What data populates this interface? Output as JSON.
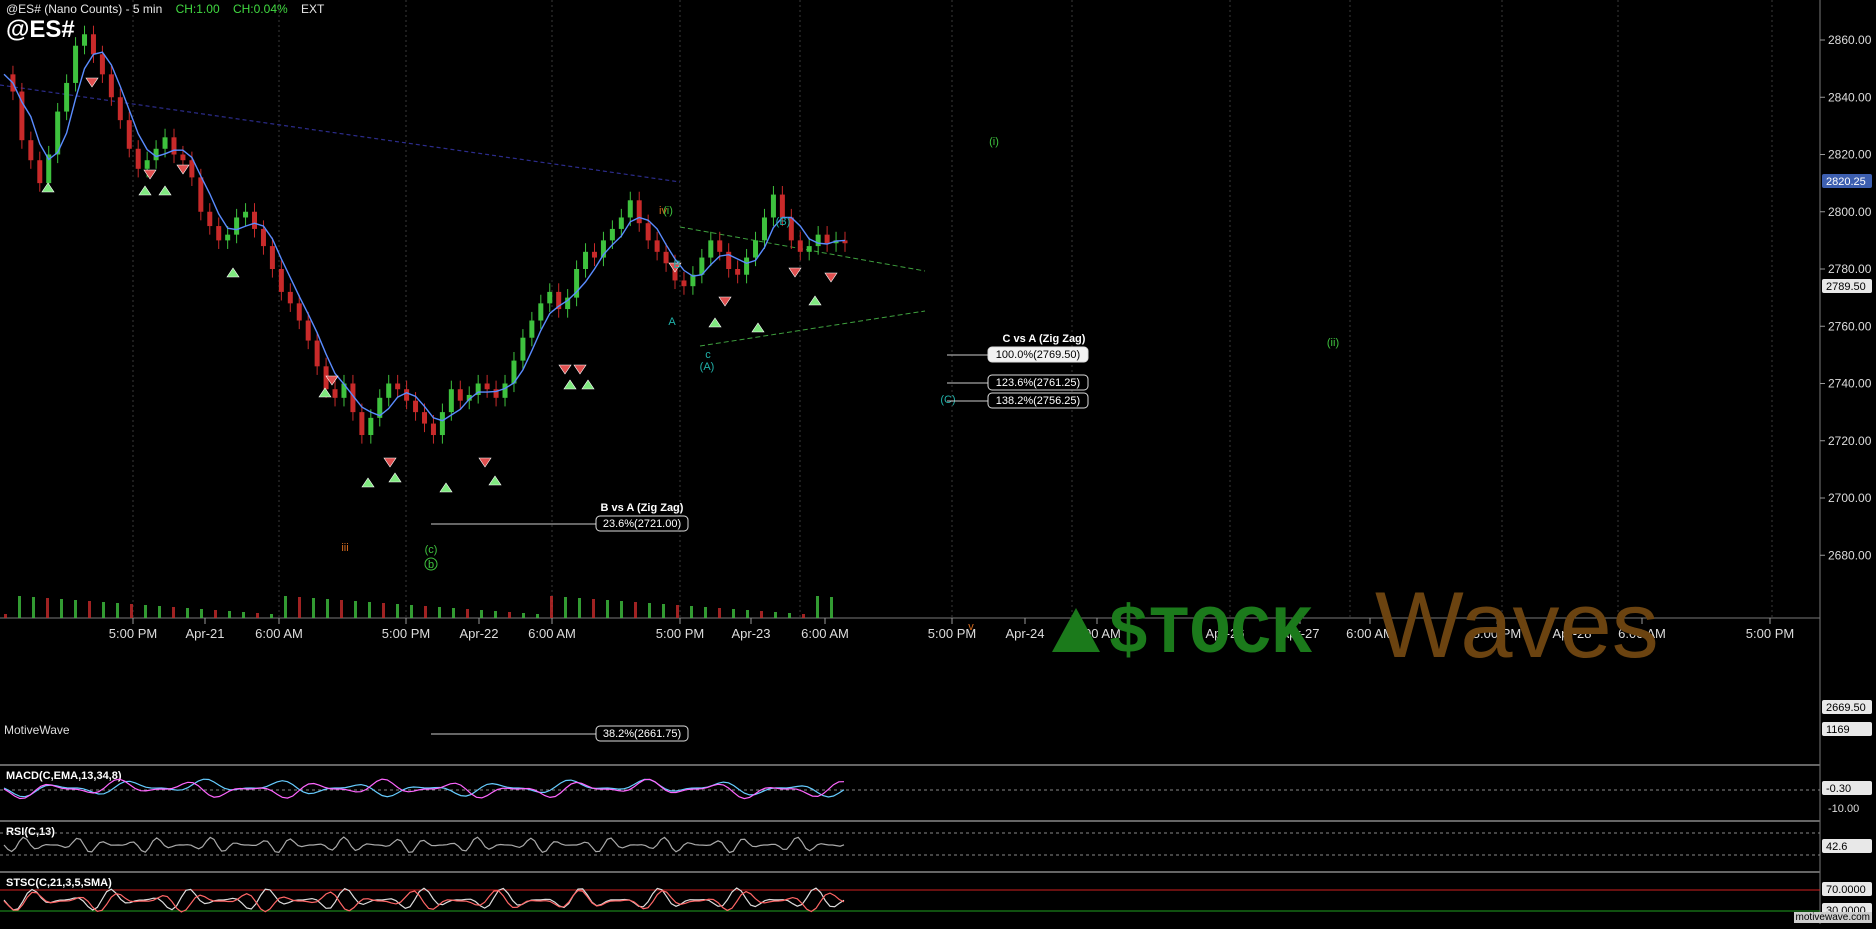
{
  "header": {
    "symbol_line": "@ES# (Nano Counts) - 5 min",
    "ch_points": "CH:1.00",
    "ch_percent": "CH:0.04%",
    "session": "EXT",
    "symbol": "@ES#"
  },
  "branding": {
    "platform": "MotiveWave",
    "watermark_prefix": "$TOCK",
    "watermark_suffix": "Waves",
    "footer_url": "motivewave.com"
  },
  "colors": {
    "background": "#000000",
    "up_candle": "#3ec23e",
    "down_candle": "#c82a2a",
    "average_line": "#5a8cff",
    "fib_label_bg": "#ffffff",
    "macd_line": "#ff66ff",
    "macd_signal": "#66ccff",
    "stoch_line": "#ff6666",
    "triangle_lines": "#3fa13f",
    "trend_line": "#2c2c8c",
    "watermark_green": "#1b7a1b",
    "watermark_brown": "#6b4310"
  },
  "chart_data": [
    {
      "type": "line",
      "name": "price",
      "y_ticks": [
        "2860.00",
        "2840.00",
        "2820.00",
        "2800.00",
        "2780.00",
        "2760.00",
        "2740.00",
        "2720.00",
        "2700.00",
        "2680.00"
      ],
      "ylim": [
        2655,
        2866
      ],
      "x_ticks": [
        "5:00 PM",
        "Apr-21",
        "6:00 AM",
        "5:00 PM",
        "Apr-22",
        "6:00 AM",
        "5:00 PM",
        "Apr-23",
        "6:00 AM",
        "5:00 PM",
        "Apr-24",
        "6:00 AM",
        "Apr-26",
        "Apr-27",
        "6:00 AM",
        "5:00 PM",
        "Apr-28",
        "6:00 AM",
        "5:00 PM"
      ],
      "price_flags": [
        {
          "label": "2820.25",
          "style": "blue"
        },
        {
          "label": "2789.50",
          "style": "white"
        },
        {
          "label": "2669.50",
          "style": "white"
        },
        {
          "label": "1169",
          "style": "white"
        }
      ],
      "series": [
        {
          "values": [
            2848,
            2842,
            2825,
            2818,
            2810,
            2820,
            2835,
            2845,
            2858,
            2862,
            2855,
            2848,
            2840,
            2832,
            2822,
            2815,
            2818,
            2822,
            2826,
            2820,
            2818,
            2812,
            2800,
            2795,
            2790,
            2792,
            2798,
            2800,
            2794,
            2788,
            2780,
            2772,
            2768,
            2762,
            2755,
            2746,
            2738,
            2735,
            2740,
            2730,
            2722,
            2728,
            2735,
            2740,
            2738,
            2734,
            2730,
            2726,
            2722,
            2730,
            2738,
            2734,
            2736,
            2740,
            2738,
            2735,
            2740,
            2748,
            2756,
            2762,
            2768,
            2772,
            2766,
            2770,
            2780,
            2786,
            2784,
            2790,
            2794,
            2798,
            2804,
            2796,
            2790,
            2786,
            2782,
            2776,
            2774,
            2778,
            2784,
            2790,
            2786,
            2780,
            2778,
            2784,
            2790,
            2798,
            2806,
            2798,
            2790,
            2786,
            2788,
            2792,
            2789,
            2790,
            2789
          ]
        }
      ],
      "annotations": [
        {
          "text": "iii",
          "color": "#d2691e"
        },
        {
          "text": "(c)",
          "color": "#3ec23e"
        },
        {
          "text": "b",
          "color": "#3ec23e",
          "circled": true
        },
        {
          "text": "iv",
          "color": "#d2691e"
        },
        {
          "text": "(i)",
          "color": "#3ec23e"
        },
        {
          "text": "B",
          "color": "#20b2aa"
        },
        {
          "text": "A",
          "color": "#20b2aa"
        },
        {
          "text": "c",
          "color": "#20b2aa"
        },
        {
          "text": "(A)",
          "color": "#20b2aa"
        },
        {
          "text": "(B)",
          "color": "#20b2aa"
        },
        {
          "text": "(C)",
          "color": "#20b2aa"
        },
        {
          "text": "(i)",
          "color": "#3ec23e"
        },
        {
          "text": "(ii)",
          "color": "#3ec23e"
        },
        {
          "text": "v",
          "color": "#d2691e"
        }
      ],
      "fib_groups": [
        {
          "title": "B vs A (Zig Zag)",
          "levels": [
            {
              "label": "23.6%(2721.00)",
              "value": 2721.0
            },
            {
              "label": "38.2%(2661.75)",
              "value": 2661.75
            }
          ]
        },
        {
          "title": "C vs A (Zig Zag)",
          "levels": [
            {
              "label": "100.0%(2769.50)",
              "value": 2769.5
            },
            {
              "label": "123.6%(2761.25)",
              "value": 2761.25
            },
            {
              "label": "138.2%(2756.25)",
              "value": 2756.25
            }
          ]
        }
      ]
    },
    {
      "type": "line",
      "name": "macd",
      "title": "MACD(C,EMA,13,34,8)",
      "y_ticks": [
        "-0.30",
        "-10.00"
      ]
    },
    {
      "type": "line",
      "name": "rsi",
      "title": "RSI(C,13)",
      "y_ticks": [
        "42.6"
      ]
    },
    {
      "type": "line",
      "name": "stoch",
      "title": "STSC(C,21,3,5,SMA)",
      "y_ticks": [
        "70.0000",
        "30.0000"
      ]
    }
  ]
}
